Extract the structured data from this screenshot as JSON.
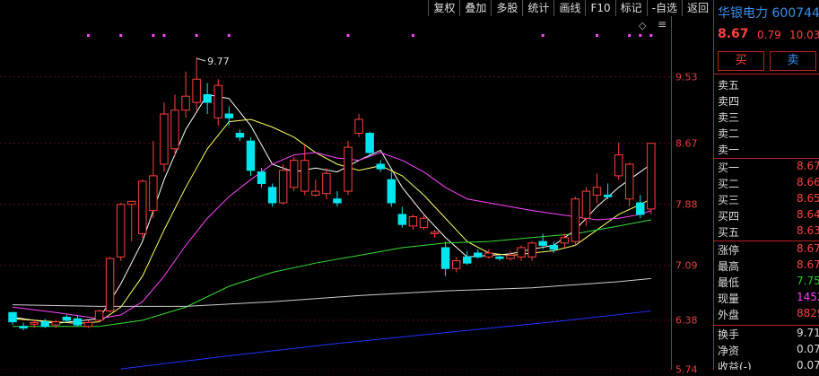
{
  "toolbar": {
    "buttons": [
      "复权",
      "叠加",
      "多股",
      "统计",
      "画线",
      "F10",
      "标记",
      "-自选",
      "返回"
    ]
  },
  "stock": {
    "name": "华银电力",
    "code": "600744",
    "price": "8.67",
    "change": "0.79",
    "pct": "10.03"
  },
  "trade": {
    "buy": "买",
    "sell": "卖"
  },
  "sell_levels": [
    "卖五",
    "卖四",
    "卖三",
    "卖二",
    "卖一"
  ],
  "buy_levels": [
    {
      "label": "买一",
      "value": "8.67"
    },
    {
      "label": "买二",
      "value": "8.66"
    },
    {
      "label": "买三",
      "value": "8.65"
    },
    {
      "label": "买四",
      "value": "8.64"
    },
    {
      "label": "买五",
      "value": "8.63"
    }
  ],
  "stats": [
    {
      "label": "涨停",
      "value": "8.67",
      "color": "#ff4040"
    },
    {
      "label": "最高",
      "value": "8.67",
      "color": "#ff4040"
    },
    {
      "label": "最低",
      "value": "7.75",
      "color": "#22cc22"
    },
    {
      "label": "现量",
      "value": "14521",
      "color": "#ff40ff"
    },
    {
      "label": "外盘",
      "value": "882995",
      "color": "#ff4040"
    }
  ],
  "stats2": [
    {
      "label": "换手",
      "value": "9.71%",
      "color": "#ddd"
    },
    {
      "label": "净资",
      "value": "0.079",
      "color": "#ddd"
    },
    {
      "label": "收益(-)",
      "value": "0.079",
      "color": "#ddd"
    }
  ],
  "annotation": "9.77",
  "axis_ticks": [
    "9.53",
    "8.67",
    "7.88",
    "7.09",
    "6.38",
    "5.74"
  ],
  "colors": {
    "up": "#ff4040",
    "down": "#00e5ee",
    "accent": "#3c8fe8",
    "ma5": "#ffffff",
    "ma10": "#ffff66",
    "ma20": "#ff44ff",
    "ma60": "#33dd33",
    "ma120": "#cccccc",
    "ma250": "#2233ff"
  },
  "chart_data": {
    "type": "candlestick",
    "ylim": [
      5.74,
      10.2
    ],
    "candles": [
      [
        6.48,
        6.49,
        6.32,
        6.36
      ],
      [
        6.3,
        6.35,
        6.25,
        6.28
      ],
      [
        6.33,
        6.38,
        6.28,
        6.35
      ],
      [
        6.36,
        6.4,
        6.28,
        6.3
      ],
      [
        6.32,
        6.38,
        6.28,
        6.36
      ],
      [
        6.42,
        6.45,
        6.35,
        6.38
      ],
      [
        6.4,
        6.44,
        6.3,
        6.32
      ],
      [
        6.3,
        6.38,
        6.28,
        6.35
      ],
      [
        6.38,
        6.52,
        6.36,
        6.5
      ],
      [
        6.5,
        7.2,
        6.48,
        7.18
      ],
      [
        7.2,
        7.9,
        7.15,
        7.88
      ],
      [
        7.88,
        7.9,
        7.4,
        7.92
      ],
      [
        7.5,
        8.2,
        7.45,
        8.18
      ],
      [
        7.8,
        8.7,
        7.7,
        8.25
      ],
      [
        8.4,
        9.2,
        8.3,
        9.05
      ],
      [
        8.6,
        9.3,
        8.5,
        9.1
      ],
      [
        9.1,
        9.6,
        9.0,
        9.28
      ],
      [
        9.2,
        9.77,
        9.1,
        9.5
      ],
      [
        9.3,
        9.45,
        9.05,
        9.2
      ],
      [
        9.0,
        9.5,
        8.9,
        9.42
      ],
      [
        9.05,
        9.15,
        8.9,
        9.0
      ],
      [
        8.8,
        8.85,
        8.7,
        8.75
      ],
      [
        8.7,
        8.75,
        8.25,
        8.32
      ],
      [
        8.3,
        8.35,
        8.1,
        8.15
      ],
      [
        8.1,
        8.15,
        7.85,
        7.9
      ],
      [
        7.9,
        8.4,
        7.88,
        8.32
      ],
      [
        8.1,
        8.5,
        8.05,
        8.45
      ],
      [
        8.05,
        8.65,
        8.0,
        8.45
      ],
      [
        8.0,
        8.2,
        7.98,
        8.05
      ],
      [
        8.02,
        8.35,
        7.95,
        8.28
      ],
      [
        7.95,
        8.05,
        7.85,
        7.9
      ],
      [
        8.05,
        8.7,
        8.0,
        8.62
      ],
      [
        8.8,
        9.05,
        8.75,
        8.98
      ],
      [
        8.8,
        8.82,
        8.5,
        8.55
      ],
      [
        8.4,
        8.45,
        8.3,
        8.34
      ],
      [
        8.2,
        8.3,
        7.85,
        7.9
      ],
      [
        7.75,
        7.85,
        7.58,
        7.62
      ],
      [
        7.6,
        7.75,
        7.55,
        7.72
      ],
      [
        7.58,
        7.75,
        7.55,
        7.7
      ],
      [
        7.5,
        7.55,
        7.45,
        7.52
      ],
      [
        7.32,
        7.4,
        6.95,
        7.05
      ],
      [
        7.05,
        7.2,
        7.0,
        7.15
      ],
      [
        7.2,
        7.28,
        7.1,
        7.12
      ],
      [
        7.25,
        7.3,
        7.18,
        7.2
      ],
      [
        7.2,
        7.3,
        7.18,
        7.25
      ],
      [
        7.2,
        7.22,
        7.15,
        7.18
      ],
      [
        7.18,
        7.28,
        7.15,
        7.22
      ],
      [
        7.2,
        7.35,
        7.15,
        7.32
      ],
      [
        7.2,
        7.4,
        7.15,
        7.38
      ],
      [
        7.4,
        7.5,
        7.3,
        7.35
      ],
      [
        7.35,
        7.4,
        7.25,
        7.3
      ],
      [
        7.38,
        7.5,
        7.32,
        7.45
      ],
      [
        7.4,
        7.98,
        7.35,
        7.95
      ],
      [
        7.7,
        8.1,
        7.6,
        8.05
      ],
      [
        8.0,
        8.28,
        7.9,
        8.1
      ],
      [
        8.0,
        8.15,
        7.95,
        7.98
      ],
      [
        8.25,
        8.68,
        8.2,
        8.52
      ],
      [
        7.95,
        8.42,
        7.85,
        8.4
      ],
      [
        7.9,
        8.0,
        7.7,
        7.75
      ],
      [
        7.82,
        8.67,
        7.75,
        8.67
      ]
    ],
    "ma": [
      {
        "name": "MA5",
        "color": "#ffffff",
        "values": [
          [
            0,
            6.42
          ],
          [
            4,
            6.34
          ],
          [
            8,
            6.4
          ],
          [
            10,
            6.85
          ],
          [
            12,
            7.4
          ],
          [
            14,
            8.2
          ],
          [
            16,
            8.85
          ],
          [
            18,
            9.3
          ],
          [
            20,
            9.25
          ],
          [
            22,
            8.9
          ],
          [
            24,
            8.4
          ],
          [
            26,
            8.3
          ],
          [
            28,
            8.35
          ],
          [
            30,
            8.3
          ],
          [
            32,
            8.45
          ],
          [
            34,
            8.58
          ],
          [
            36,
            8.1
          ],
          [
            38,
            7.75
          ],
          [
            40,
            7.45
          ],
          [
            42,
            7.2
          ],
          [
            44,
            7.22
          ],
          [
            46,
            7.24
          ],
          [
            48,
            7.3
          ],
          [
            50,
            7.35
          ],
          [
            52,
            7.55
          ],
          [
            54,
            7.85
          ],
          [
            56,
            8.1
          ],
          [
            58,
            8.3
          ],
          [
            59,
            8.4
          ]
        ]
      },
      {
        "name": "MA10",
        "color": "#ffff66",
        "values": [
          [
            0,
            6.4
          ],
          [
            6,
            6.34
          ],
          [
            8,
            6.36
          ],
          [
            10,
            6.55
          ],
          [
            12,
            6.95
          ],
          [
            14,
            7.55
          ],
          [
            16,
            8.1
          ],
          [
            18,
            8.6
          ],
          [
            20,
            8.95
          ],
          [
            22,
            8.98
          ],
          [
            24,
            8.88
          ],
          [
            26,
            8.75
          ],
          [
            28,
            8.55
          ],
          [
            30,
            8.4
          ],
          [
            32,
            8.32
          ],
          [
            34,
            8.38
          ],
          [
            36,
            8.25
          ],
          [
            38,
            8.0
          ],
          [
            40,
            7.7
          ],
          [
            42,
            7.4
          ],
          [
            44,
            7.25
          ],
          [
            46,
            7.22
          ],
          [
            48,
            7.25
          ],
          [
            50,
            7.28
          ],
          [
            52,
            7.35
          ],
          [
            54,
            7.55
          ],
          [
            56,
            7.75
          ],
          [
            58,
            7.88
          ],
          [
            59,
            7.95
          ]
        ]
      },
      {
        "name": "MA20",
        "color": "#ff44ff",
        "values": [
          [
            0,
            6.55
          ],
          [
            4,
            6.48
          ],
          [
            8,
            6.4
          ],
          [
            10,
            6.45
          ],
          [
            12,
            6.62
          ],
          [
            14,
            6.95
          ],
          [
            16,
            7.35
          ],
          [
            18,
            7.7
          ],
          [
            20,
            7.98
          ],
          [
            22,
            8.2
          ],
          [
            24,
            8.4
          ],
          [
            26,
            8.52
          ],
          [
            28,
            8.55
          ],
          [
            30,
            8.48
          ],
          [
            32,
            8.45
          ],
          [
            34,
            8.55
          ],
          [
            36,
            8.45
          ],
          [
            38,
            8.3
          ],
          [
            40,
            8.1
          ],
          [
            42,
            7.95
          ],
          [
            44,
            7.9
          ],
          [
            46,
            7.85
          ],
          [
            48,
            7.8
          ],
          [
            50,
            7.76
          ],
          [
            52,
            7.72
          ],
          [
            54,
            7.68
          ],
          [
            56,
            7.7
          ],
          [
            58,
            7.75
          ],
          [
            59,
            7.8
          ]
        ]
      },
      {
        "name": "MA60",
        "color": "#33dd33",
        "values": [
          [
            0,
            6.3
          ],
          [
            8,
            6.3
          ],
          [
            12,
            6.38
          ],
          [
            16,
            6.55
          ],
          [
            20,
            6.82
          ],
          [
            24,
            7.0
          ],
          [
            28,
            7.12
          ],
          [
            32,
            7.22
          ],
          [
            36,
            7.32
          ],
          [
            40,
            7.38
          ],
          [
            44,
            7.4
          ],
          [
            48,
            7.45
          ],
          [
            52,
            7.5
          ],
          [
            56,
            7.6
          ],
          [
            59,
            7.68
          ]
        ]
      },
      {
        "name": "MA120",
        "color": "#cccccc",
        "values": [
          [
            0,
            6.58
          ],
          [
            8,
            6.56
          ],
          [
            16,
            6.56
          ],
          [
            24,
            6.62
          ],
          [
            32,
            6.7
          ],
          [
            40,
            6.76
          ],
          [
            48,
            6.8
          ],
          [
            56,
            6.88
          ],
          [
            59,
            6.92
          ]
        ]
      },
      {
        "name": "MA250",
        "color": "#2233ff",
        "values": [
          [
            10,
            5.75
          ],
          [
            20,
            5.92
          ],
          [
            30,
            6.08
          ],
          [
            40,
            6.22
          ],
          [
            50,
            6.36
          ],
          [
            59,
            6.5
          ]
        ]
      }
    ]
  }
}
